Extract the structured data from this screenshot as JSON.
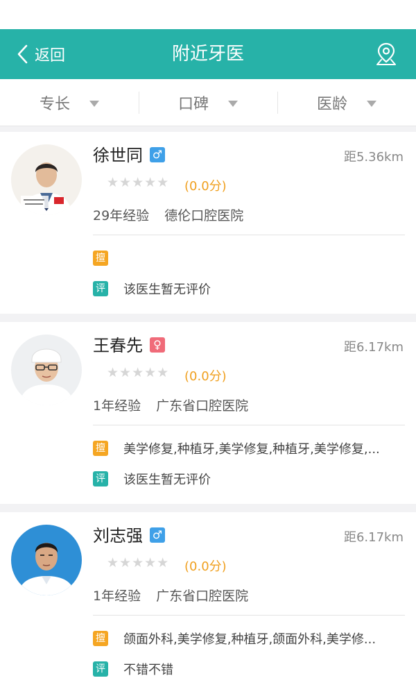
{
  "nav": {
    "back_label": "返回",
    "title": "附近牙医",
    "bg_color": "#27b2a8"
  },
  "filters": [
    {
      "label": "专长"
    },
    {
      "label": "口碑"
    },
    {
      "label": "医龄"
    }
  ],
  "doctors": [
    {
      "name": "徐世同",
      "gender": "male",
      "gender_symbol": "♂",
      "distance": "距5.36km",
      "stars": "★★★★★",
      "score": "(0.0分)",
      "experience": "29年经验",
      "hospital": "德伦口腔医院",
      "skill_tag": "擅",
      "skills": "",
      "review_tag": "评",
      "review": "该医生暂无评价"
    },
    {
      "name": "王春先",
      "gender": "female",
      "gender_symbol": "♀",
      "distance": "距6.17km",
      "stars": "★★★★★",
      "score": "(0.0分)",
      "experience": "1年经验",
      "hospital": "广东省口腔医院",
      "skill_tag": "擅",
      "skills": "美学修复,种植牙,美学修复,种植牙,美学修复,...",
      "review_tag": "评",
      "review": "该医生暂无评价"
    },
    {
      "name": "刘志强",
      "gender": "male",
      "gender_symbol": "♂",
      "distance": "距6.17km",
      "stars": "★★★★★",
      "score": "(0.0分)",
      "experience": "1年经验",
      "hospital": "广东省口腔医院",
      "skill_tag": "擅",
      "skills": "颌面外科,美学修复,种植牙,颌面外科,美学修...",
      "review_tag": "评",
      "review": "不错不错"
    }
  ],
  "colors": {
    "accent": "#27b2a8",
    "male": "#3fa0e8",
    "female": "#f06b79",
    "skill_tag": "#f5a623",
    "score": "#f0a020"
  }
}
